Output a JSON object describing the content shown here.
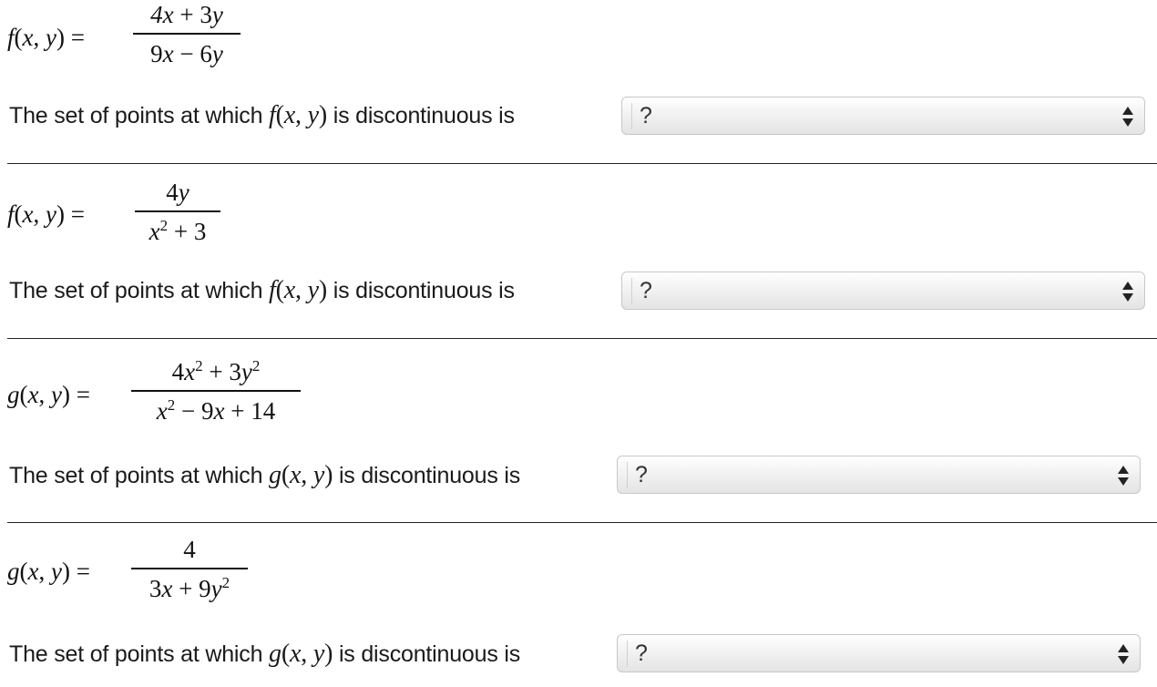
{
  "problems": [
    {
      "lhs_func": "f",
      "numerator": "4x + 3y",
      "denominator": "9x − 6y",
      "question_prefix": "The set of points at which",
      "question_func": "f",
      "question_suffix": "is discontinuous is",
      "select_value": "?"
    },
    {
      "lhs_func": "f",
      "numerator": "4y",
      "denominator": "x² + 3",
      "question_prefix": "The set of points at which",
      "question_func": "f",
      "question_suffix": "is discontinuous is",
      "select_value": "?"
    },
    {
      "lhs_func": "g",
      "numerator": "4x² + 3y²",
      "denominator": "x² − 9x + 14",
      "question_prefix": "The set of points at which",
      "question_func": "g",
      "question_suffix": "is discontinuous is",
      "select_value": "?"
    },
    {
      "lhs_func": "g",
      "numerator": "4",
      "denominator": "3x + 9y²",
      "question_prefix": "The set of points at which",
      "question_func": "g",
      "question_suffix": "is discontinuous is",
      "select_value": "?"
    }
  ],
  "icons": {
    "select_arrows": "up-down-arrows-icon"
  }
}
